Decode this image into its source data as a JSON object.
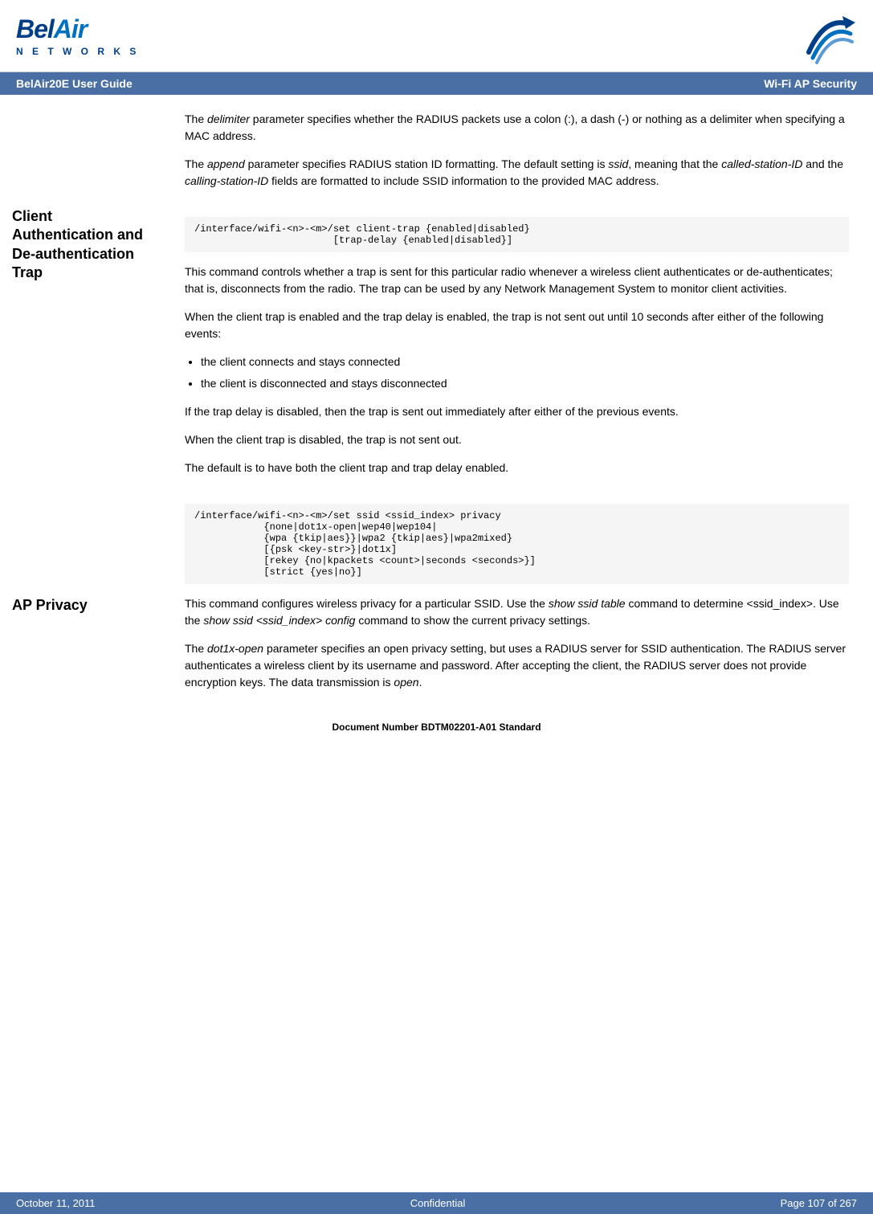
{
  "header": {
    "logo_bel": "Bel",
    "logo_air": "Air",
    "logo_networks": "N E T W O R K S"
  },
  "navbar": {
    "left": "BelAir20E User Guide",
    "right": "Wi-Fi AP Security"
  },
  "sidebar": {
    "section1_title": "Client Authentication and De-authentication Trap",
    "section2_title": "AP Privacy"
  },
  "content": {
    "para1": "The delimiter parameter specifies whether the RADIUS packets use a colon (:), a dash (-) or nothing as a delimiter when specifying a MAC address.",
    "para1_italic": "delimiter",
    "para2_pre": "The ",
    "para2_italic": "append",
    "para2_post": " parameter specifies RADIUS station ID formatting. The default setting is ssid, meaning that the called-station-ID and the calling-station-ID fields are formatted to include SSID information to the provided MAC address.",
    "para2_ssid_italic": "ssid",
    "para2_called_italic": "called-station-ID",
    "para2_calling_italic": "calling-station-ID",
    "code1": "/interface/wifi-<n>-<m>/set client-trap {enabled|disabled}\n                        [trap-delay {enabled|disabled}]",
    "para3": "This command controls whether a trap is sent for this particular radio whenever a wireless client authenticates or de-authenticates; that is, disconnects from the radio. The trap can be used by any Network Management System to monitor client activities.",
    "para4": "When the client trap is enabled and the trap delay is enabled, the trap is not sent out until 10 seconds after either of the following events:",
    "bullet1": "the client connects and stays connected",
    "bullet2": "the client is disconnected and stays disconnected",
    "para5": "If the trap delay is disabled, then the trap is sent out immediately after either of the previous events.",
    "para6": "When the client trap is disabled, the trap is not sent out.",
    "para7": "The default is to have both the client trap and trap delay enabled.",
    "code2": "/interface/wifi-<n>-<m>/set ssid <ssid_index> privacy\n            {none|dot1x-open|wep40|wep104|\n            {wpa {tkip|aes}}|wpa2 {tkip|aes}|wpa2mixed}\n            [{psk <key-str>}|dot1x]\n            [rekey {no|kpackets <count>|seconds <seconds>}]\n            [strict {yes|no}]",
    "para8_pre": "This command configures wireless privacy for a particular SSID. Use the ",
    "para8_italic1": "show ssid table",
    "para8_mid": " command to determine <ssid_index>. Use the ",
    "para8_italic2": "show ssid <ssid_index> config",
    "para8_post": " command to show the current privacy settings.",
    "para9_pre": "The ",
    "para9_italic": "dot1x-open",
    "para9_post": " parameter specifies an open privacy setting, but uses a RADIUS server for SSID authentication. The RADIUS server authenticates a wireless client by its username and password. After accepting the client, the RADIUS server does not provide encryption keys. The data transmission is open.",
    "para9_last_italic": "open"
  },
  "footer": {
    "left": "October 11, 2011",
    "center": "Confidential",
    "right": "Page 107 of 267",
    "doc": "Document Number BDTM02201-A01 Standard"
  }
}
